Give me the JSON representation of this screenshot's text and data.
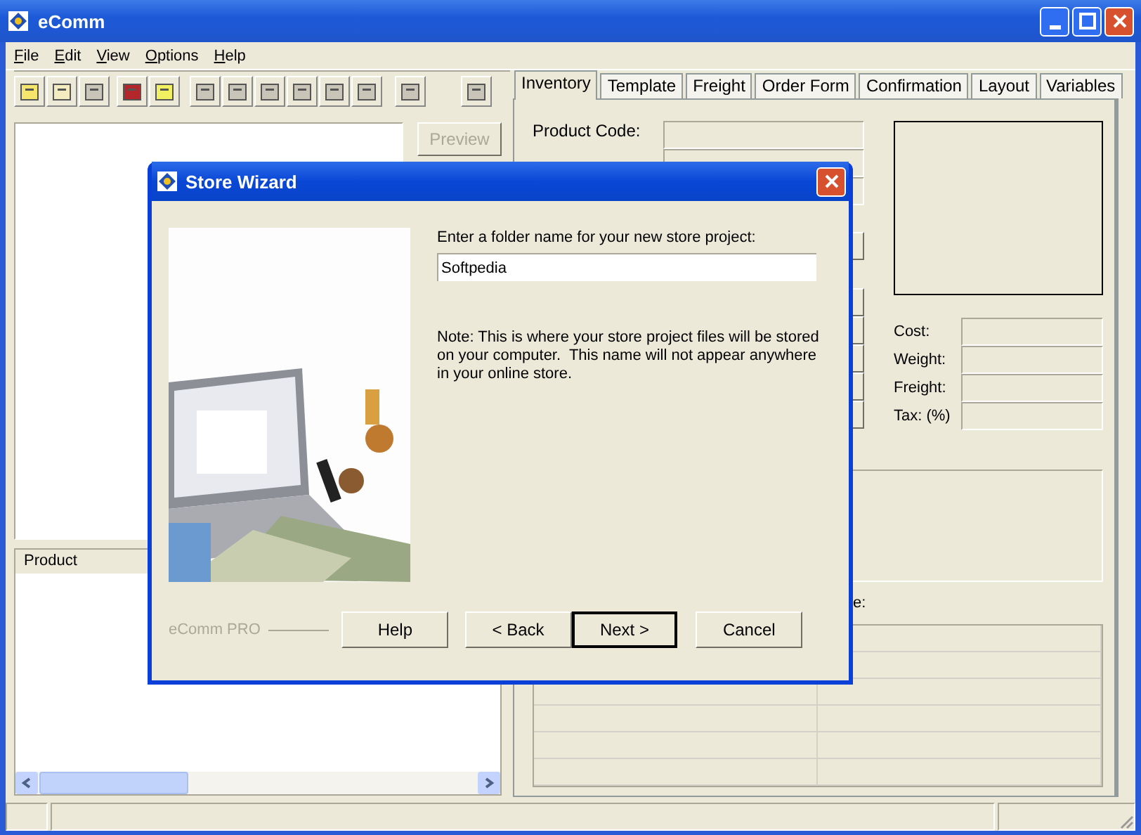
{
  "window": {
    "title": "eComm"
  },
  "menu": [
    {
      "label": "File"
    },
    {
      "label": "Edit"
    },
    {
      "label": "View"
    },
    {
      "label": "Options"
    },
    {
      "label": "Help"
    }
  ],
  "preview_button": {
    "label": "Preview",
    "disabled": true
  },
  "product_list": {
    "column": "Product"
  },
  "tabs": [
    {
      "label": "Inventory",
      "selected": true
    },
    {
      "label": "Template",
      "selected": false
    },
    {
      "label": "Freight",
      "selected": false
    },
    {
      "label": "Order Form",
      "selected": false
    },
    {
      "label": "Confirmation",
      "selected": false
    },
    {
      "label": "Layout",
      "selected": false
    },
    {
      "label": "Variables",
      "selected": false
    }
  ],
  "inventory": {
    "product_code_label": "Product Code:",
    "pricing": [
      {
        "label": "Cost:"
      },
      {
        "label": "Weight:"
      },
      {
        "label": "Freight:"
      },
      {
        "label": "Tax: (%)"
      }
    ],
    "partial_label": "e:"
  },
  "dialog": {
    "title": "Store Wizard",
    "prompt": "Enter a folder name for your new store project:",
    "folder_name": "Softpedia",
    "note": "Note: This is where your store project files will be stored on your computer.  This name will not appear anywhere in your online store.",
    "brand": "eComm PRO",
    "buttons": [
      {
        "label": "Help",
        "default": false
      },
      {
        "label": "< Back",
        "default": false
      },
      {
        "label": "Next >",
        "default": true
      },
      {
        "label": "Cancel",
        "default": false
      }
    ]
  }
}
